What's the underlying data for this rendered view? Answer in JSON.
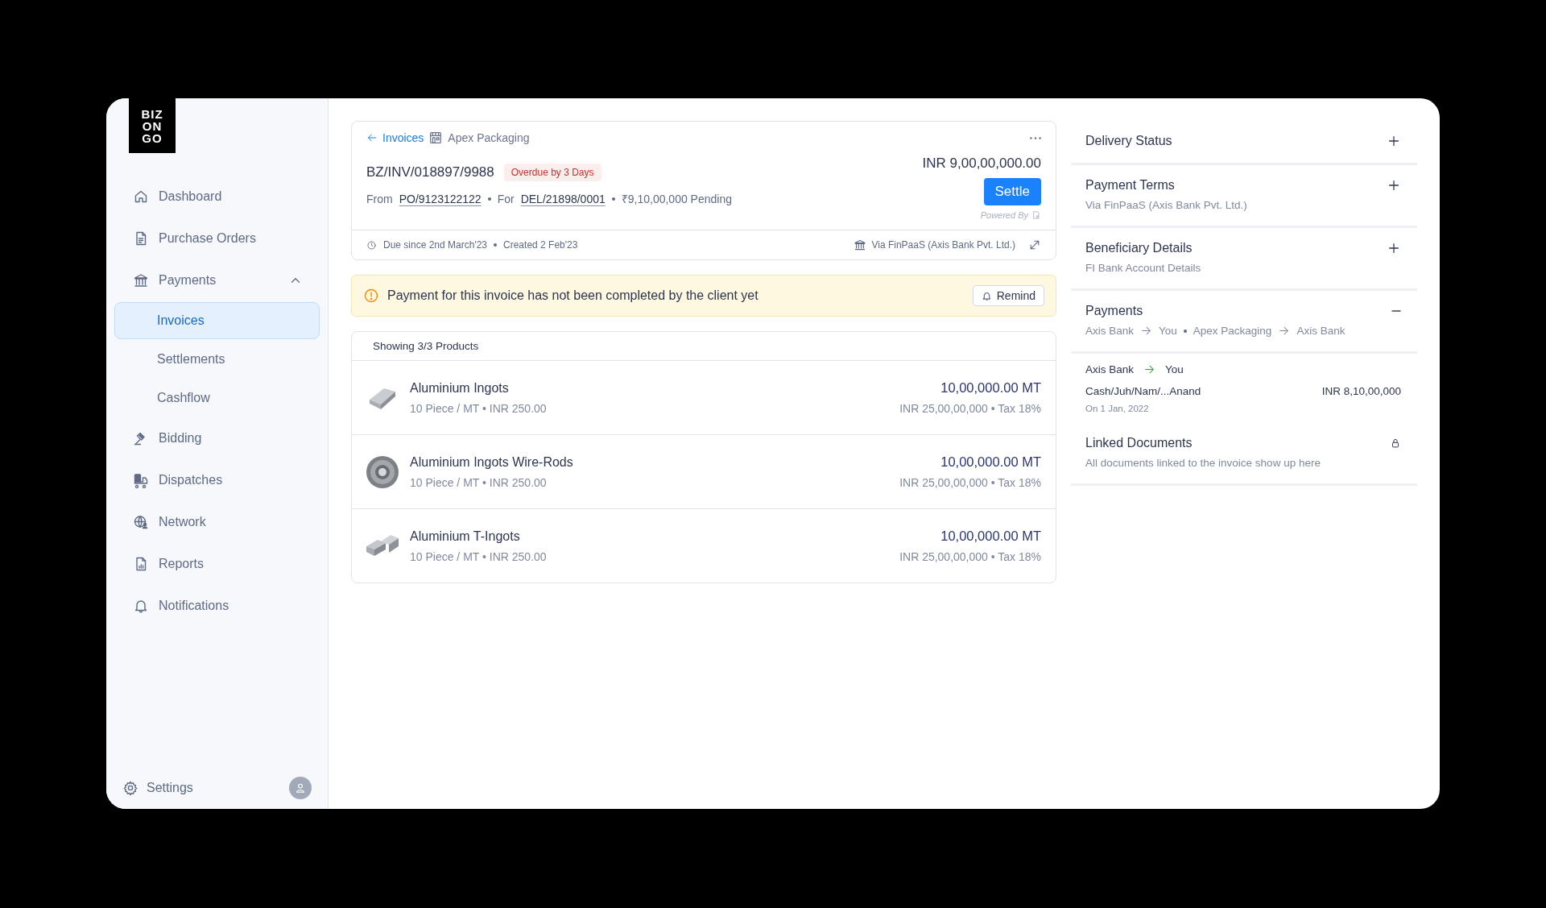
{
  "logo": {
    "lines": [
      "BIZ",
      "ON",
      "GO"
    ]
  },
  "sidebar": {
    "items": [
      {
        "label": "Dashboard",
        "selected": false
      },
      {
        "label": "Purchase Orders",
        "selected": false
      },
      {
        "label": "Payments",
        "selected": false,
        "expanded": true,
        "children": [
          {
            "label": "Invoices",
            "selected": true
          },
          {
            "label": "Settlements",
            "selected": false
          },
          {
            "label": "Cashflow",
            "selected": false
          }
        ]
      },
      {
        "label": "Bidding",
        "selected": false
      },
      {
        "label": "Dispatches",
        "selected": false
      },
      {
        "label": "Network",
        "selected": false
      },
      {
        "label": "Reports",
        "selected": false
      },
      {
        "label": "Notifications",
        "selected": false
      }
    ],
    "settings": "Settings"
  },
  "invoice": {
    "back": "Invoices",
    "company": "Apex Packaging",
    "number": "BZ/INV/018897/9988",
    "badge": "Overdue by 3 Days",
    "from_label": "From",
    "po": "PO/9123122122",
    "for_label": "For",
    "delivery": "DEL/21898/0001",
    "pending": "₹9,10,00,000 Pending",
    "amount": "INR 9,00,00,000.00",
    "settle": "Settle",
    "powered_by": "Powered By",
    "due": "Due since 2nd March'23",
    "created": "Created 2 Feb'23",
    "via": "Via FinPaaS (Axis Bank Pvt. Ltd.)"
  },
  "alert": {
    "message": "Payment for this invoice has not been completed by the client yet",
    "button": "Remind"
  },
  "products": {
    "heading": "Showing 3/3 Products",
    "rows": [
      {
        "name": "Aluminium Ingots",
        "detail": "10 Piece / MT • INR 250.00",
        "quantity": "10,00,000.00 MT",
        "total": "INR 25,00,00,000 • Tax 18%"
      },
      {
        "name": "Aluminium Ingots Wire-Rods",
        "detail": "10 Piece / MT • INR 250.00",
        "quantity": "10,00,000.00 MT",
        "total": "INR 25,00,00,000 • Tax 18%"
      },
      {
        "name": "Aluminium T-Ingots",
        "detail": "10 Piece / MT • INR 250.00",
        "quantity": "10,00,000.00 MT",
        "total": "INR 25,00,00,000 • Tax 18%"
      }
    ]
  },
  "panel": {
    "sections": [
      {
        "kind": "accordion",
        "title": "Delivery Status",
        "expanded": false
      },
      {
        "kind": "accordion",
        "title": "Payment Terms",
        "subtitle": "Via FinPaaS (Axis Bank Pvt. Ltd.)",
        "expanded": false
      },
      {
        "kind": "accordion",
        "title": "Beneficiary Details",
        "subtitle": "FI Bank Account Details",
        "expanded": false
      },
      {
        "kind": "accordion",
        "title": "Payments",
        "expanded": true,
        "route": [
          {
            "from": "Axis Bank",
            "to": "You"
          },
          {
            "from": "Apex Packaging",
            "to": "Axis Bank"
          }
        ],
        "entries": [
          {
            "from": "Axis Bank",
            "to": "You",
            "reference": "Cash/Juh/Nam/...Anand",
            "amount": "INR 8,10,00,000",
            "date": "On 1 Jan, 2022"
          }
        ]
      },
      {
        "kind": "locked",
        "title": "Linked Documents",
        "subtitle": "All documents linked to the invoice show up here"
      }
    ]
  }
}
